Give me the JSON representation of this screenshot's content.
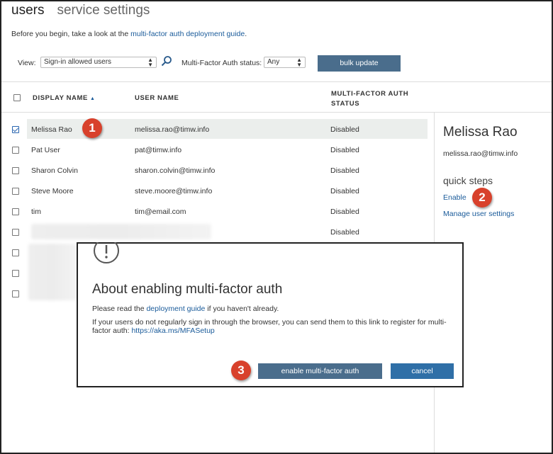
{
  "tabs": [
    {
      "label": "users"
    },
    {
      "label": "service settings"
    }
  ],
  "intro": {
    "text": "Before you begin, take a look at the ",
    "link": "multi-factor auth deployment guide",
    "suffix": "."
  },
  "filters": {
    "view_label": "View:",
    "view_value": "Sign-in allowed users",
    "mfa_label": "Multi-Factor Auth status:",
    "mfa_value": "Any",
    "bulk_update": "bulk update"
  },
  "table": {
    "headers": {
      "display_name": "DISPLAY NAME",
      "user_name": "USER NAME",
      "mfa_status_line1": "MULTI-FACTOR AUTH",
      "mfa_status_line2": "STATUS"
    },
    "rows": [
      {
        "name": "Melissa Rao",
        "user": "melissa.rao@timw.info",
        "status": "Disabled",
        "checked": true
      },
      {
        "name": "Pat User",
        "user": "pat@timw.info",
        "status": "Disabled",
        "checked": false
      },
      {
        "name": "Sharon Colvin",
        "user": "sharon.colvin@timw.info",
        "status": "Disabled",
        "checked": false
      },
      {
        "name": "Steve Moore",
        "user": "steve.moore@timw.info",
        "status": "Disabled",
        "checked": false
      },
      {
        "name": "tim",
        "user": "tim@email.com",
        "status": "Disabled",
        "checked": false
      },
      {
        "name": "",
        "user": "",
        "status": "Disabled",
        "checked": false
      }
    ]
  },
  "side_panel": {
    "name": "Melissa Rao",
    "email": "melissa.rao@timw.info",
    "quick_steps": "quick steps",
    "enable": "Enable",
    "manage": "Manage user settings"
  },
  "badges": {
    "one": "1",
    "two": "2",
    "three": "3"
  },
  "dialog": {
    "title": "About enabling multi-factor auth",
    "p1_prefix": "Please read the ",
    "p1_link": "deployment guide",
    "p1_suffix": " if you haven't already.",
    "p2_text": "If your users do not regularly sign in through the browser, you can send them to this link to register for multi-factor auth: ",
    "p2_link": "https://aka.ms/MFASetup",
    "enable_button": "enable multi-factor auth",
    "cancel_button": "cancel"
  },
  "colors": {
    "accent_button": "#4a6d8c",
    "cancel_button": "#2f6fa7",
    "link": "#1a5b9a",
    "badge": "#d8412c"
  }
}
